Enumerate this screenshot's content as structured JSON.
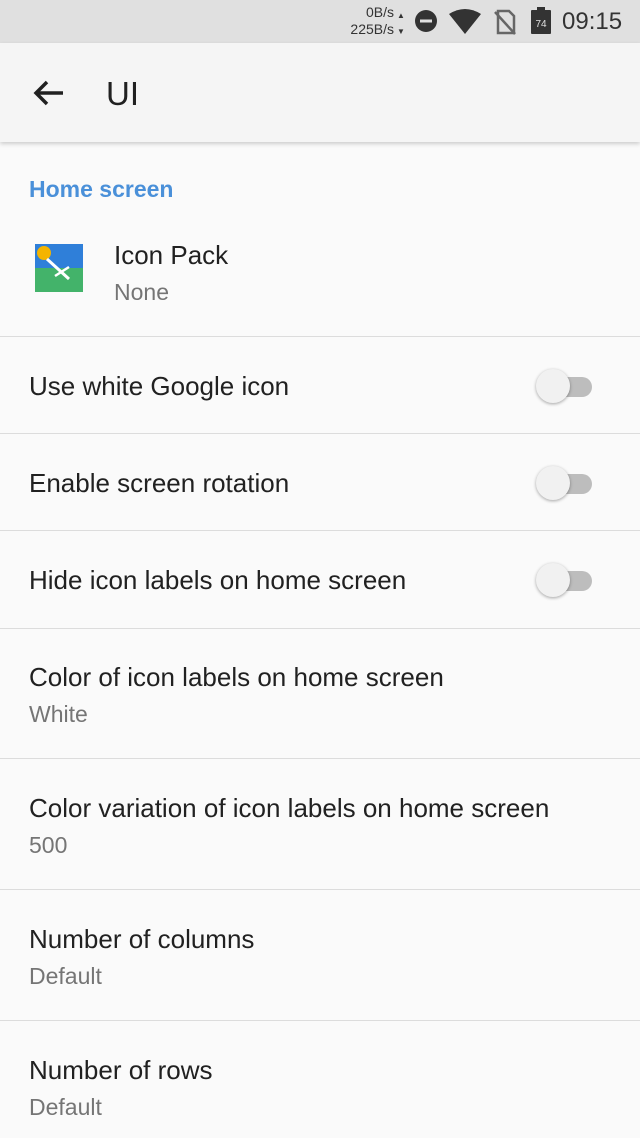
{
  "status_bar": {
    "net_up": "0B/s",
    "net_down": "225B/s",
    "battery_level": "74",
    "time": "09:15",
    "icons": [
      "dnd-icon",
      "wifi-icon",
      "no-sim-icon",
      "battery-icon"
    ]
  },
  "app_bar": {
    "back_icon": "back-arrow-icon",
    "title": "UI"
  },
  "section": {
    "header": "Home screen"
  },
  "prefs": {
    "icon_pack": {
      "title": "Icon Pack",
      "summary": "None"
    },
    "white_google_icon": {
      "title": "Use white Google icon",
      "enabled": false
    },
    "screen_rotation": {
      "title": "Enable screen rotation",
      "enabled": false
    },
    "hide_labels": {
      "title": "Hide icon labels on home screen",
      "enabled": false
    },
    "label_color": {
      "title": "Color of icon labels on home screen",
      "summary": "White"
    },
    "label_color_variation": {
      "title": "Color variation of icon labels on home screen",
      "summary": "500"
    },
    "columns": {
      "title": "Number of columns",
      "summary": "Default"
    },
    "rows": {
      "title": "Number of rows",
      "summary": "Default"
    }
  },
  "colors": {
    "accent": "#4a90d9",
    "status_bar_bg": "#e0e0e0",
    "toggle_off_track": "#bdbdbd"
  }
}
